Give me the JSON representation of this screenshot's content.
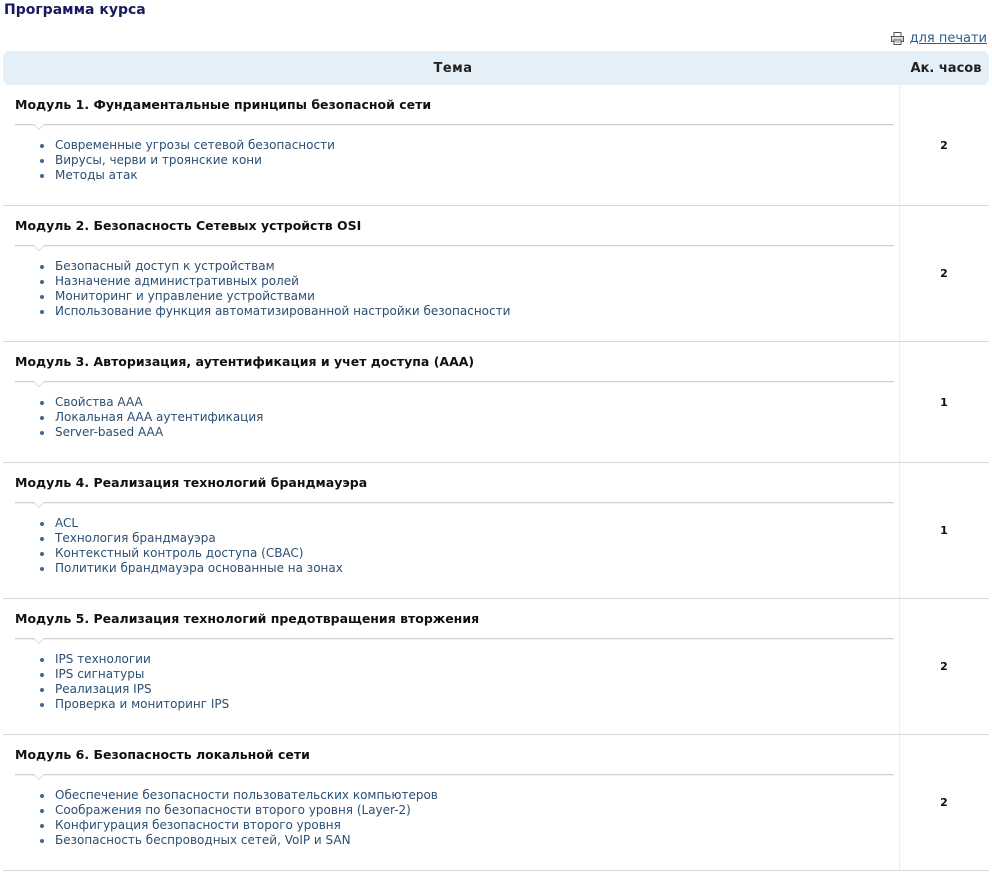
{
  "page": {
    "title": "Программа курса",
    "print_link": "для печати",
    "print_icon": "printer-icon"
  },
  "table": {
    "headers": {
      "topic": "Тема",
      "hours": "Ак. часов"
    },
    "modules": [
      {
        "title": "Модуль 1. Фундаментальные принципы безопасной сети",
        "hours": "2",
        "topics": [
          "Современные угрозы сетевой безопасности",
          "Вирусы, черви и троянские кони",
          "Методы атак"
        ]
      },
      {
        "title": "Модуль 2. Безопасность Сетевых устройств OSI",
        "hours": "2",
        "topics": [
          "Безопасный доступ к устройствам",
          "Назначение административных ролей",
          "Мониторинг и управление устройствами",
          "Использование функция автоматизированной настройки безопасности"
        ]
      },
      {
        "title": "Модуль 3. Авторизация, аутентификация и учет доступа (AAA)",
        "hours": "1",
        "topics": [
          "Свойства AAA",
          "Локальная AAA аутентификация",
          "Server-based AAA"
        ]
      },
      {
        "title": "Модуль 4. Реализация технологий брандмауэра",
        "hours": "1",
        "topics": [
          "ACL",
          "Технология брандмауэра",
          "Контекстный контроль доступа (CBAC)",
          "Политики брандмауэра основанные на зонах"
        ]
      },
      {
        "title": "Модуль 5. Реализация технологий предотвращения вторжения",
        "hours": "2",
        "topics": [
          "IPS технологии",
          "IPS сигнатуры",
          "Реализация IPS",
          "Проверка и мониторинг IPS"
        ]
      },
      {
        "title": "Модуль 6. Безопасность локальной сети",
        "hours": "2",
        "topics": [
          "Обеспечение безопасности пользовательских компьютеров",
          "Соображения по безопасности второго уровня (Layer-2)",
          "Конфигурация безопасности второго уровня",
          "Безопасность беспроводных сетей, VoIP и SAN"
        ]
      }
    ]
  },
  "colors": {
    "title": "#1a1a60",
    "header_bg": "#e4eff8",
    "link": "#2b5f92",
    "topic_text": "#2b4f73"
  }
}
